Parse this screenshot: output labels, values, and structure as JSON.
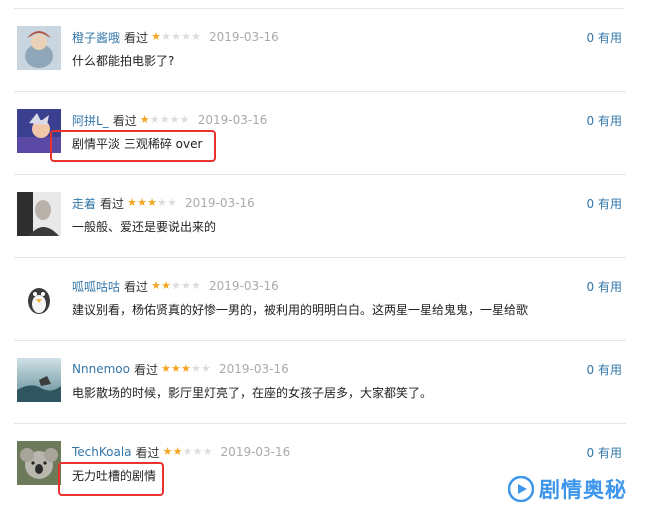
{
  "comments": [
    {
      "user": "橙子酱哦",
      "watched": "看过",
      "rating": 1,
      "date": "2019-03-16",
      "votes": "0 有用",
      "text": "什么都能拍电影了?"
    },
    {
      "user": "阿拼L_",
      "watched": "看过",
      "rating": 1,
      "date": "2019-03-16",
      "votes": "0 有用",
      "text": "剧情平淡 三观稀碎 over"
    },
    {
      "user": "走着",
      "watched": "看过",
      "rating": 3,
      "date": "2019-03-16",
      "votes": "0 有用",
      "text": "一般般、爱还是要说出来的"
    },
    {
      "user": "呱呱咕咕",
      "watched": "看过",
      "rating": 2,
      "date": "2019-03-16",
      "votes": "0 有用",
      "text": "建议别看，杨佑贤真的好惨一男的，被利用的明明白白。这两星一星给鬼鬼，一星给歌"
    },
    {
      "user": "Nnnemoo",
      "watched": "看过",
      "rating": 3,
      "date": "2019-03-16",
      "votes": "0 有用",
      "text": "电影散场的时候，影厅里灯亮了，在座的女孩子居多，大家都笑了。"
    },
    {
      "user": "TechKoala",
      "watched": "看过",
      "rating": 2,
      "date": "2019-03-16",
      "votes": "0 有用",
      "text": "无力吐槽的剧情"
    }
  ],
  "watermark": {
    "text": "剧情奥秘",
    "icon": "play-icon"
  },
  "colors": {
    "link": "#3377aa",
    "star": "#f5a623",
    "highlight": "#e8322e",
    "watermark": "#3d96ec"
  }
}
